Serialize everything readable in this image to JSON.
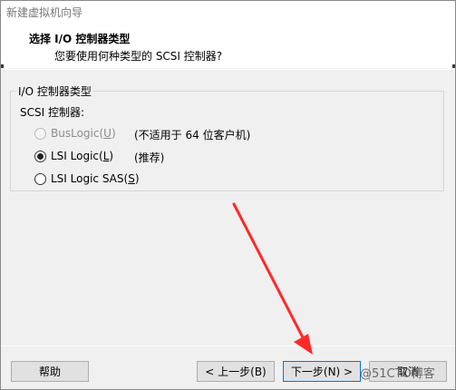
{
  "window": {
    "title": "新建虚拟机向导"
  },
  "header": {
    "title": "选择 I/O 控制器类型",
    "subtitle": "您要使用何种类型的 SCSI 控制器?"
  },
  "group": {
    "label": "I/O 控制器类型",
    "scsi_label": "SCSI 控制器:"
  },
  "options": [
    {
      "label": "BusLogic(",
      "key": "U",
      "suffix": ")",
      "note": "(不适用于 64 位客户机)",
      "selected": false,
      "disabled": true
    },
    {
      "label": "LSI Logic(",
      "key": "L",
      "suffix": ")",
      "note": "(推荐)",
      "selected": true,
      "disabled": false
    },
    {
      "label": "LSI Logic SAS(",
      "key": "S",
      "suffix": ")",
      "note": "",
      "selected": false,
      "disabled": false
    }
  ],
  "buttons": {
    "help": "帮助",
    "back": "< 上一步(B)",
    "next": "下一步(N) >",
    "cancel": "取消"
  },
  "watermark": "@51CTO博客",
  "colors": {
    "arrow": "#ff2a2a",
    "focus": "#0078d7"
  }
}
